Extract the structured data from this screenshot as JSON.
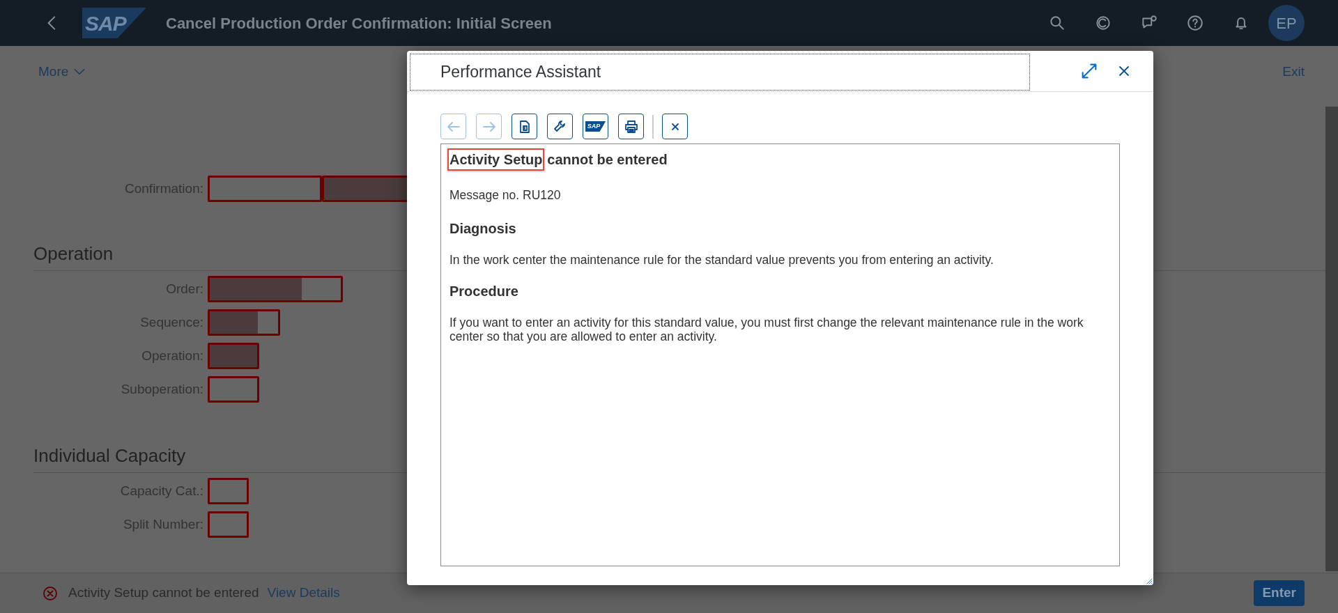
{
  "shell": {
    "logo": "SAP",
    "title": "Cancel Production Order Confirmation: Initial Screen",
    "avatar": "EP"
  },
  "page_toolbar": {
    "more": "More",
    "exit": "Exit"
  },
  "confirmation": {
    "label": "Confirmation:",
    "inputs": [
      {
        "redacted": false
      },
      {
        "redacted": true
      }
    ]
  },
  "sections": [
    {
      "heading": "Operation",
      "fields": [
        {
          "label": "Order:",
          "redacted": true
        },
        {
          "label": "Sequence:",
          "redacted": true
        },
        {
          "label": "Operation:",
          "redacted": true
        },
        {
          "label": "Suboperation:",
          "redacted": false
        }
      ]
    },
    {
      "heading": "Individual Capacity",
      "fields": [
        {
          "label": "Capacity Cat.:",
          "redacted": false
        },
        {
          "label": "Split Number:",
          "redacted": false
        }
      ]
    }
  ],
  "dialog": {
    "title": "Performance Assistant",
    "tools": [
      {
        "kind": "back",
        "disabled": true
      },
      {
        "kind": "forward",
        "disabled": true
      },
      {
        "kind": "document",
        "disabled": false
      },
      {
        "kind": "wrench",
        "disabled": false
      },
      {
        "kind": "logo",
        "label": "SAP",
        "disabled": false
      },
      {
        "kind": "print",
        "disabled": false
      },
      {
        "kind": "separator"
      },
      {
        "kind": "close",
        "disabled": false
      }
    ],
    "message": {
      "title_highlighted": "Activity Setup",
      "title_rest": "cannot be entered",
      "number": "Message no. RU120",
      "sections": [
        {
          "heading": "Diagnosis",
          "text": "In the work center the maintenance rule for the standard value prevents you from entering an activity."
        },
        {
          "heading": "Procedure",
          "text": "If you want to enter an activity for this standard value, you must first change the relevant maintenance rule in the work center so that you are allowed to enter an activity."
        }
      ]
    }
  },
  "footer": {
    "message": "Activity Setup cannot be entered",
    "link": "View Details",
    "button": "Enter"
  }
}
